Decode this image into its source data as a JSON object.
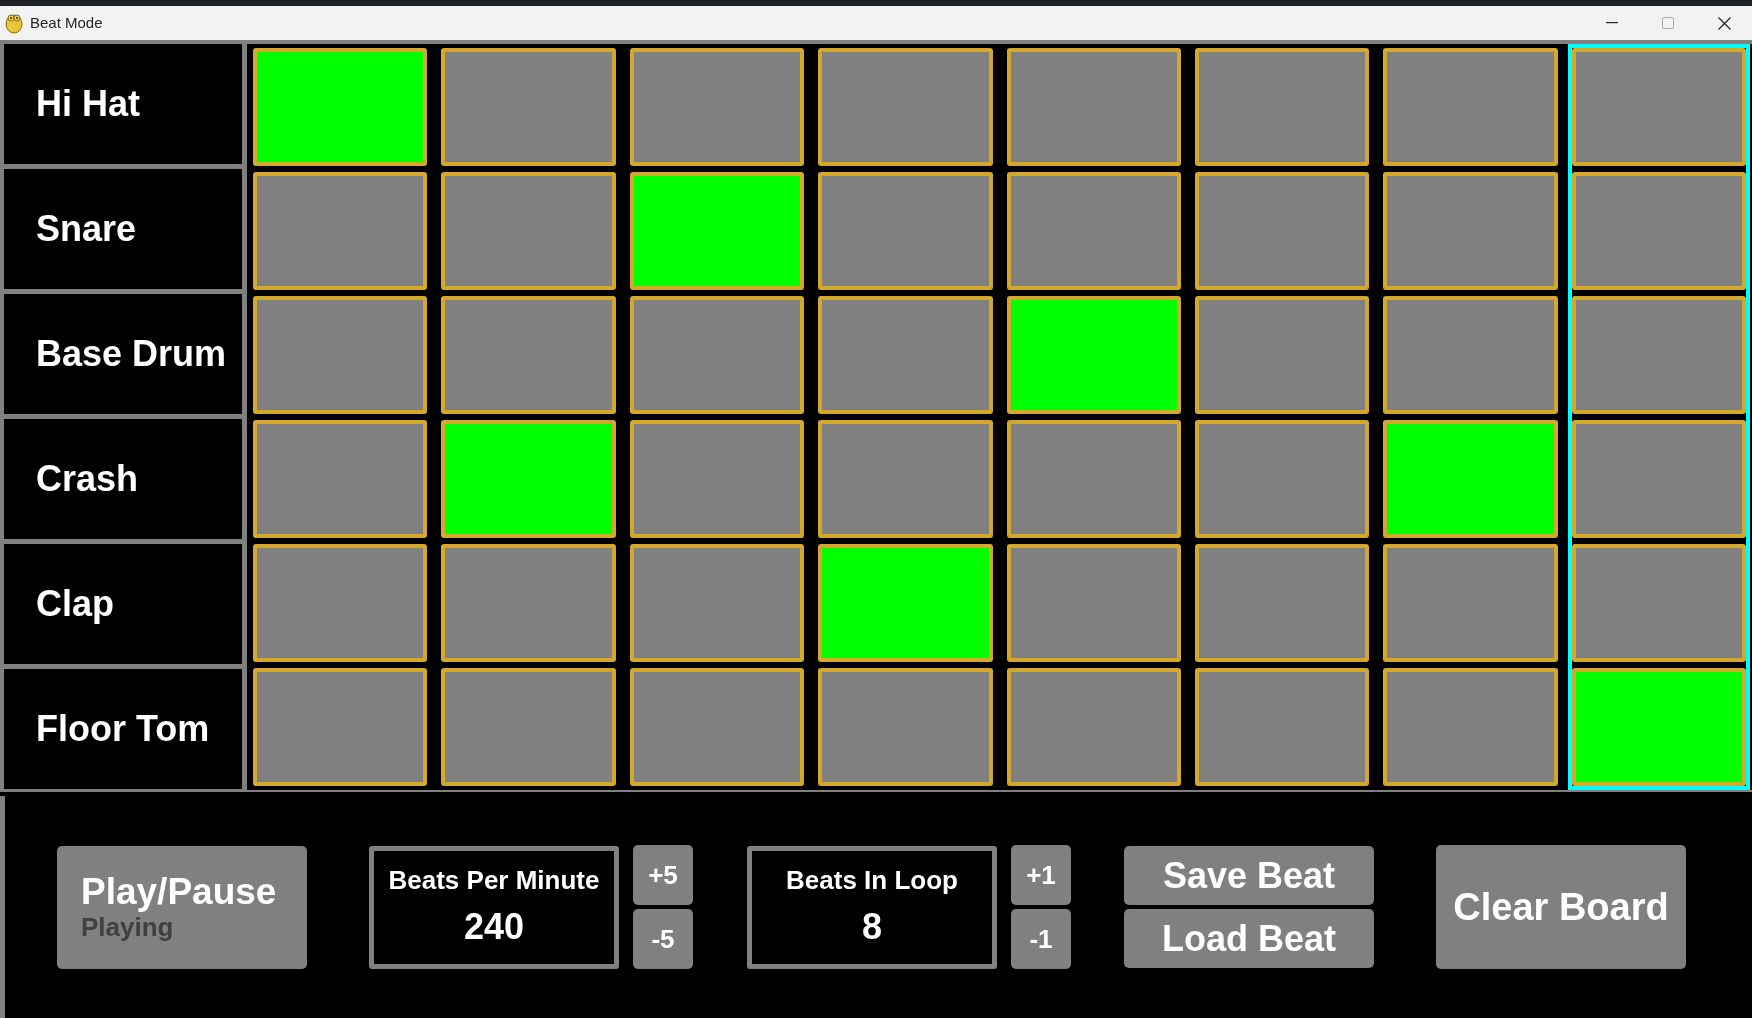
{
  "window": {
    "title": "Beat Mode"
  },
  "columns": [
    {
      "selected": false
    },
    {
      "selected": false
    },
    {
      "selected": false
    },
    {
      "selected": false
    },
    {
      "selected": false
    },
    {
      "selected": false
    },
    {
      "selected": false
    },
    {
      "selected": true
    }
  ],
  "tracks": [
    {
      "name": "Hi Hat",
      "steps": [
        true,
        false,
        false,
        false,
        false,
        false,
        false,
        false
      ]
    },
    {
      "name": "Snare",
      "steps": [
        false,
        false,
        true,
        false,
        false,
        false,
        false,
        false
      ]
    },
    {
      "name": "Base Drum",
      "steps": [
        false,
        false,
        false,
        false,
        true,
        false,
        false,
        false
      ]
    },
    {
      "name": "Crash",
      "steps": [
        false,
        true,
        false,
        false,
        false,
        false,
        true,
        false
      ]
    },
    {
      "name": "Clap",
      "steps": [
        false,
        false,
        false,
        true,
        false,
        false,
        false,
        false
      ]
    },
    {
      "name": "Floor Tom",
      "steps": [
        false,
        false,
        false,
        false,
        false,
        false,
        false,
        true
      ]
    }
  ],
  "controls": {
    "play_pause": {
      "label": "Play/Pause",
      "status": "Playing"
    },
    "bpm": {
      "label": "Beats Per Minute",
      "value": "240",
      "up": "+5",
      "down": "-5"
    },
    "loop": {
      "label": "Beats In Loop",
      "value": "8",
      "up": "+1",
      "down": "-1"
    },
    "save": "Save Beat",
    "load": "Load Beat",
    "clear": "Clear Board"
  }
}
